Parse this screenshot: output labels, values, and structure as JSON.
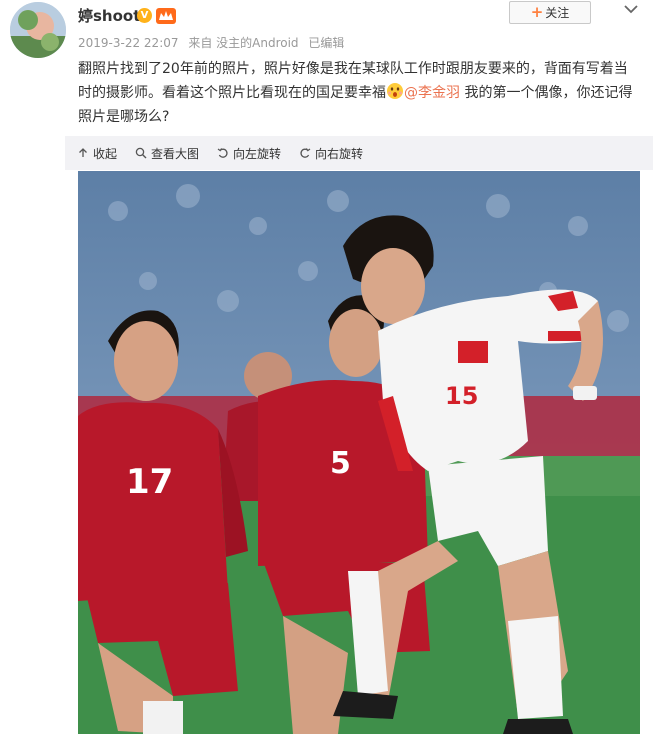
{
  "user": {
    "name": "婷shoot",
    "vip_badge": "V",
    "follow_label": "关注",
    "follow_plus": "+"
  },
  "post": {
    "date": "2019-3-22 22:07",
    "source": "来自 没主的Android",
    "edited": "已编辑",
    "text_part1": "翻照片找到了20年前的照片，照片好像是我在某球队工作时跟朋友要来的，背面有写着当时的摄影师。看着这个照片比看现在的国足要幸福",
    "mention": "@李金羽",
    "text_part2": " 我的第一个偶像，你还记得照片是哪场么?"
  },
  "image_tools": {
    "collapse": "收起",
    "view_large": "查看大图",
    "rotate_left": "向左旋转",
    "rotate_right": "向右旋转"
  },
  "photo": {
    "jersey_numbers": [
      "17",
      "5",
      "15"
    ]
  },
  "colors": {
    "mention": "#eb7350",
    "toolbar_bg": "#f2f2f5",
    "home_red": "#b8182a",
    "away_white": "#f5f5f5",
    "pitch_green": "#3f8f4a"
  },
  "icons": {
    "collapse": "arrow-up-icon",
    "view_large": "magnifier-icon",
    "rotate_left": "rotate-left-icon",
    "rotate_right": "rotate-right-icon",
    "more": "chevron-down-icon"
  }
}
